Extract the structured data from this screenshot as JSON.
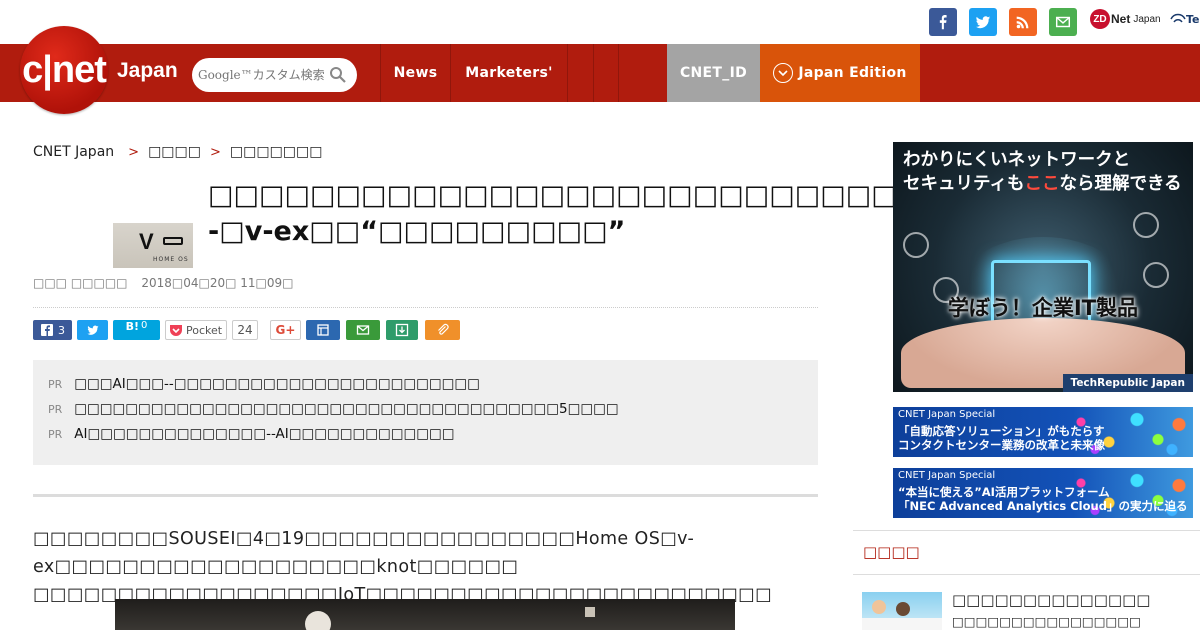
{
  "header": {
    "logo_text": "c|net",
    "logo_suffix": "Japan",
    "search_placeholder": "Google™カスタム検索",
    "nav": [
      {
        "label": "News"
      },
      {
        "label": "Marketers'"
      },
      {
        "label": ""
      },
      {
        "label": ""
      },
      {
        "label": ""
      }
    ],
    "cnet_id": "CNET_ID",
    "edition": "Japan Edition",
    "zdnet_label": "Net",
    "zdnet_suffix": "Japan",
    "techrepublic_label": "Te"
  },
  "social_icons": [
    {
      "icon": "facebook-icon",
      "color": "#3b5998"
    },
    {
      "icon": "twitter-icon",
      "color": "#1da1f2"
    },
    {
      "icon": "rss-icon",
      "color": "#f26522"
    },
    {
      "icon": "mail-icon",
      "color": "#4caf50"
    }
  ],
  "breadcrumb": {
    "items": [
      "CNET Japan",
      "□□□□",
      "□□□□□□□"
    ],
    "separator": ">"
  },
  "article": {
    "title": "□□□□□□□□□□□□□□□□□□□□□□□□□□□--□v-ex□□“□□□□□□□□□”",
    "thumb_text": "V",
    "thumb_caption": "HOME OS",
    "author": "□□□ □□□□□",
    "date": "2018□04□20□ 11□09□",
    "share": {
      "facebook_count": "3",
      "hatena_label": "B!",
      "hatena_count": "0",
      "pocket_label": "Pocket",
      "pocket_count": "24"
    },
    "pr": [
      {
        "tag": "PR",
        "text": "□□□AI□□□--□□□□□□□□□□□□□□□□□□□□□□□□"
      },
      {
        "tag": "PR",
        "text": "□□□□□□□□□□□□□□□□□□□□□□□□□□□□□□□□□□□□□□5□□□□"
      },
      {
        "tag": "PR",
        "text": "AI□□□□□□□□□□□□□□--AI□□□□□□□□□□□□□"
      }
    ],
    "lead": "□□□□□□□□SOUSEI□4□19□□□□□□□□□□□□□□□□Home OS□v-ex□□□□□□□□□□□□□□□□□□□knot□□□□□□ □□□□□□□□□□□□□□□□□□IoT□□□□□□□□□□□□□□□□□□□□□□□□"
  },
  "sidebar": {
    "ad_headline_1": "わかりにくいネットワークと",
    "ad_headline_2_pre": "セキュリティも",
    "ad_headline_2_hl": "ここ",
    "ad_headline_2_post": "なら理解できる",
    "ad_tagline": "学ぼう！企業IT製品",
    "ad_brand": "TechRepublic Japan",
    "banners": [
      {
        "label": "CNET Japan Special",
        "line1": "「自動応答ソリューション」がもたらす",
        "line2": "コンタクトセンター業務の改革と未来像"
      },
      {
        "label": "CNET Japan Special",
        "line1": "“本当に使える”AI活用プラットフォーム",
        "line2": "「NEC Advanced Analytics Cloud」の実力に迫る"
      }
    ],
    "ranking_heading": "□□□□",
    "ranking_item_title": "□□□□□□□□□□□□□□",
    "ranking_item_sub": "□□□□□□□□□□□□□□□□"
  }
}
